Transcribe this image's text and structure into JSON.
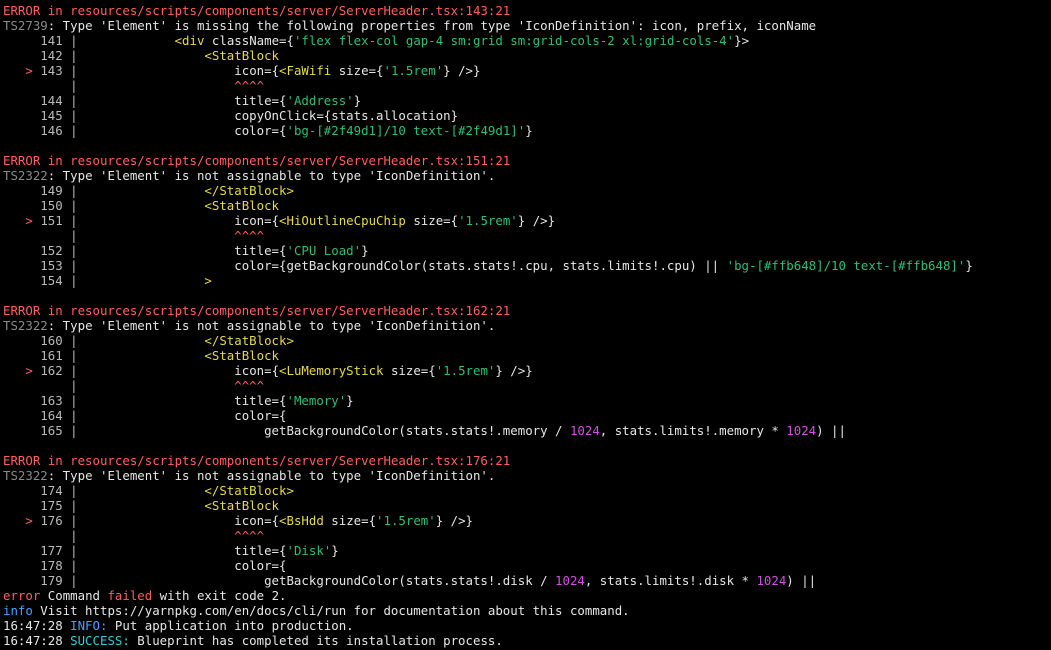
{
  "terminal": {
    "lines": [
      [
        {
          "t": "ERROR in resources/scripts/components/server/ServerHeader.tsx:143:21",
          "c": "err"
        }
      ],
      [
        {
          "t": "TS2739",
          "c": "ts"
        },
        {
          "t": ": Type 'Element' is missing the following properties from type 'IconDefinition': icon, prefix, iconName"
        }
      ],
      [
        {
          "t": "     141 | ",
          "c": "lnno"
        },
        {
          "t": "            "
        },
        {
          "t": "<div",
          "c": "tag"
        },
        {
          "t": " className={"
        },
        {
          "t": "'flex flex-col gap-4 sm:grid sm:grid-cols-2 xl:grid-cols-4'",
          "c": "str"
        },
        {
          "t": "}>"
        }
      ],
      [
        {
          "t": "     142 | ",
          "c": "lnno"
        },
        {
          "t": "                "
        },
        {
          "t": "<StatBlock",
          "c": "tag"
        }
      ],
      [
        {
          "t": "   > ",
          "c": "marker"
        },
        {
          "t": "143 | ",
          "c": "lnno"
        },
        {
          "t": "                    icon={"
        },
        {
          "t": "<FaWifi",
          "c": "tag"
        },
        {
          "t": " size={"
        },
        {
          "t": "'1.5rem'",
          "c": "str"
        },
        {
          "t": "} />}"
        }
      ],
      [
        {
          "t": "         | ",
          "c": "lnno"
        },
        {
          "t": "                    "
        },
        {
          "t": "^^^^",
          "c": "err"
        }
      ],
      [
        {
          "t": "     144 | ",
          "c": "lnno"
        },
        {
          "t": "                    title={"
        },
        {
          "t": "'Address'",
          "c": "str"
        },
        {
          "t": "}"
        }
      ],
      [
        {
          "t": "     145 | ",
          "c": "lnno"
        },
        {
          "t": "                    copyOnClick={stats.allocation}"
        }
      ],
      [
        {
          "t": "     146 | ",
          "c": "lnno"
        },
        {
          "t": "                    color={"
        },
        {
          "t": "'bg-[#2f49d1]/10 text-[#2f49d1]'",
          "c": "str"
        },
        {
          "t": "}"
        }
      ],
      [],
      [
        {
          "t": "ERROR in resources/scripts/components/server/ServerHeader.tsx:151:21",
          "c": "err"
        }
      ],
      [
        {
          "t": "TS2322",
          "c": "ts"
        },
        {
          "t": ": Type 'Element' is not assignable to type 'IconDefinition'."
        }
      ],
      [
        {
          "t": "     149 | ",
          "c": "lnno"
        },
        {
          "t": "                "
        },
        {
          "t": "</StatBlock>",
          "c": "tag"
        }
      ],
      [
        {
          "t": "     150 | ",
          "c": "lnno"
        },
        {
          "t": "                "
        },
        {
          "t": "<StatBlock",
          "c": "tag"
        }
      ],
      [
        {
          "t": "   > ",
          "c": "marker"
        },
        {
          "t": "151 | ",
          "c": "lnno"
        },
        {
          "t": "                    icon={"
        },
        {
          "t": "<HiOutlineCpuChip",
          "c": "tag"
        },
        {
          "t": " size={"
        },
        {
          "t": "'1.5rem'",
          "c": "str"
        },
        {
          "t": "} />}"
        }
      ],
      [
        {
          "t": "         | ",
          "c": "lnno"
        },
        {
          "t": "                    "
        },
        {
          "t": "^^^^",
          "c": "err"
        }
      ],
      [
        {
          "t": "     152 | ",
          "c": "lnno"
        },
        {
          "t": "                    title={"
        },
        {
          "t": "'CPU Load'",
          "c": "str"
        },
        {
          "t": "}"
        }
      ],
      [
        {
          "t": "     153 | ",
          "c": "lnno"
        },
        {
          "t": "                    color={getBackgroundColor(stats.stats!.cpu, stats.limits!.cpu) || "
        },
        {
          "t": "'bg-[#ffb648]/10 text-[#ffb648]'",
          "c": "str"
        },
        {
          "t": "}"
        }
      ],
      [
        {
          "t": "     154 | ",
          "c": "lnno"
        },
        {
          "t": "                "
        },
        {
          "t": ">",
          "c": "tag"
        }
      ],
      [],
      [
        {
          "t": "ERROR in resources/scripts/components/server/ServerHeader.tsx:162:21",
          "c": "err"
        }
      ],
      [
        {
          "t": "TS2322",
          "c": "ts"
        },
        {
          "t": ": Type 'Element' is not assignable to type 'IconDefinition'."
        }
      ],
      [
        {
          "t": "     160 | ",
          "c": "lnno"
        },
        {
          "t": "                "
        },
        {
          "t": "</StatBlock>",
          "c": "tag"
        }
      ],
      [
        {
          "t": "     161 | ",
          "c": "lnno"
        },
        {
          "t": "                "
        },
        {
          "t": "<StatBlock",
          "c": "tag"
        }
      ],
      [
        {
          "t": "   > ",
          "c": "marker"
        },
        {
          "t": "162 | ",
          "c": "lnno"
        },
        {
          "t": "                    icon={"
        },
        {
          "t": "<LuMemoryStick",
          "c": "tag"
        },
        {
          "t": " size={"
        },
        {
          "t": "'1.5rem'",
          "c": "str"
        },
        {
          "t": "} />}"
        }
      ],
      [
        {
          "t": "         | ",
          "c": "lnno"
        },
        {
          "t": "                    "
        },
        {
          "t": "^^^^",
          "c": "err"
        }
      ],
      [
        {
          "t": "     163 | ",
          "c": "lnno"
        },
        {
          "t": "                    title={"
        },
        {
          "t": "'Memory'",
          "c": "str"
        },
        {
          "t": "}"
        }
      ],
      [
        {
          "t": "     164 | ",
          "c": "lnno"
        },
        {
          "t": "                    color={"
        }
      ],
      [
        {
          "t": "     165 | ",
          "c": "lnno"
        },
        {
          "t": "                        getBackgroundColor(stats.stats!.memory / "
        },
        {
          "t": "1024",
          "c": "num"
        },
        {
          "t": ", stats.limits!.memory * "
        },
        {
          "t": "1024",
          "c": "num"
        },
        {
          "t": ") ||"
        }
      ],
      [],
      [
        {
          "t": "ERROR in resources/scripts/components/server/ServerHeader.tsx:176:21",
          "c": "err"
        }
      ],
      [
        {
          "t": "TS2322",
          "c": "ts"
        },
        {
          "t": ": Type 'Element' is not assignable to type 'IconDefinition'."
        }
      ],
      [
        {
          "t": "     174 | ",
          "c": "lnno"
        },
        {
          "t": "                "
        },
        {
          "t": "</StatBlock>",
          "c": "tag"
        }
      ],
      [
        {
          "t": "     175 | ",
          "c": "lnno"
        },
        {
          "t": "                "
        },
        {
          "t": "<StatBlock",
          "c": "tag"
        }
      ],
      [
        {
          "t": "   > ",
          "c": "marker"
        },
        {
          "t": "176 | ",
          "c": "lnno"
        },
        {
          "t": "                    icon={"
        },
        {
          "t": "<BsHdd",
          "c": "tag"
        },
        {
          "t": " size={"
        },
        {
          "t": "'1.5rem'",
          "c": "str"
        },
        {
          "t": "} />}"
        }
      ],
      [
        {
          "t": "         | ",
          "c": "lnno"
        },
        {
          "t": "                    "
        },
        {
          "t": "^^^^",
          "c": "err"
        }
      ],
      [
        {
          "t": "     177 | ",
          "c": "lnno"
        },
        {
          "t": "                    title={"
        },
        {
          "t": "'Disk'",
          "c": "str"
        },
        {
          "t": "}"
        }
      ],
      [
        {
          "t": "     178 | ",
          "c": "lnno"
        },
        {
          "t": "                    color={"
        }
      ],
      [
        {
          "t": "     179 | ",
          "c": "lnno"
        },
        {
          "t": "                        getBackgroundColor(stats.stats!.disk / "
        },
        {
          "t": "1024",
          "c": "num"
        },
        {
          "t": ", stats.limits!.disk * "
        },
        {
          "t": "1024",
          "c": "num"
        },
        {
          "t": ") ||"
        }
      ],
      [
        {
          "t": "error",
          "c": "err"
        },
        {
          "t": " Command "
        },
        {
          "t": "failed",
          "c": "err"
        },
        {
          "t": " with exit code 2."
        }
      ],
      [
        {
          "t": "info",
          "c": "info"
        },
        {
          "t": " Visit https://yarnpkg.com/en/docs/cli/run for documentation about this command."
        }
      ],
      [
        {
          "t": "16:47:28 ",
          "c": "time"
        },
        {
          "t": "INFO:",
          "c": "info"
        },
        {
          "t": " Put application into production."
        }
      ],
      [
        {
          "t": "16:47:28 ",
          "c": "time"
        },
        {
          "t": "SUCCESS:",
          "c": "succ"
        },
        {
          "t": " Blueprint has completed its installation process."
        }
      ]
    ]
  }
}
